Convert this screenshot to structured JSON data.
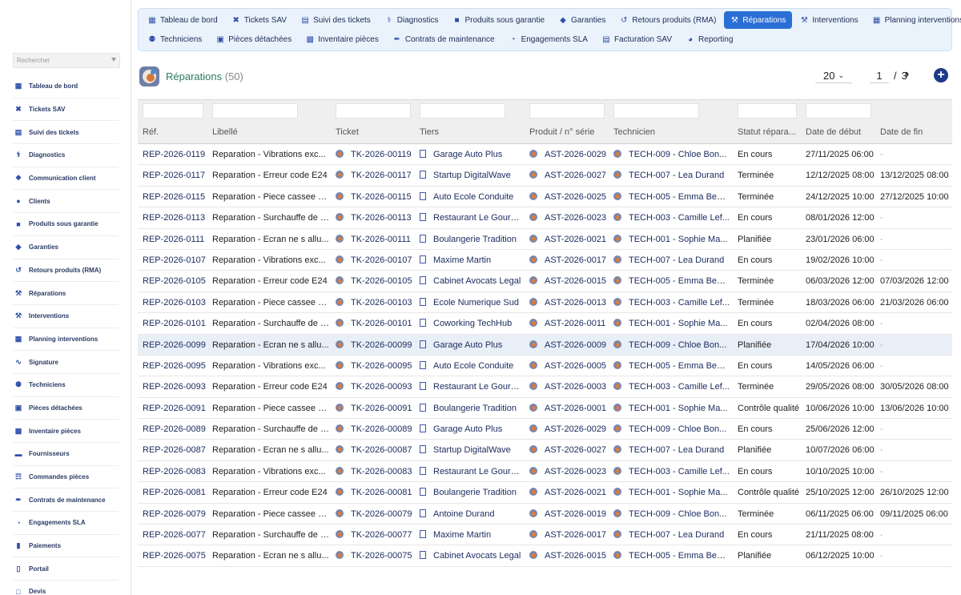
{
  "sidebar": {
    "search_placeholder": "Rechercher",
    "items": [
      {
        "label": "Tableau de bord",
        "icon": "dashboard-icon"
      },
      {
        "label": "Tickets SAV",
        "icon": "ticket-icon"
      },
      {
        "label": "Suivi des tickets",
        "icon": "table-icon"
      },
      {
        "label": "Diagnostics",
        "icon": "stethoscope-icon"
      },
      {
        "label": "Communication client",
        "icon": "chat-icon"
      },
      {
        "label": "Clients",
        "icon": "user-icon"
      },
      {
        "label": "Produits sous garantie",
        "icon": "briefcase-icon"
      },
      {
        "label": "Garanties",
        "icon": "shield-icon"
      },
      {
        "label": "Retours produits (RMA)",
        "icon": "undo-icon"
      },
      {
        "label": "Réparations",
        "icon": "tools-icon"
      },
      {
        "label": "Interventions",
        "icon": "wrench-icon"
      },
      {
        "label": "Planning interventions",
        "icon": "calendar-icon"
      },
      {
        "label": "Signature",
        "icon": "signature-icon"
      },
      {
        "label": "Techniciens",
        "icon": "users-icon"
      },
      {
        "label": "Pièces détachées",
        "icon": "cube-icon"
      },
      {
        "label": "Inventaire pièces",
        "icon": "boxes-icon"
      },
      {
        "label": "Fournisseurs",
        "icon": "truck-icon"
      },
      {
        "label": "Commandes pièces",
        "icon": "cart-icon"
      },
      {
        "label": "Contrats de maintenance",
        "icon": "contract-icon"
      },
      {
        "label": "Engagements SLA",
        "icon": "clock-icon"
      },
      {
        "label": "Paiements",
        "icon": "money-icon"
      },
      {
        "label": "Portail",
        "icon": "tablet-icon"
      },
      {
        "label": "Devis",
        "icon": "file-icon"
      }
    ]
  },
  "topmenu": {
    "row1": [
      {
        "label": "Tableau de bord",
        "icon": "dashboard-icon"
      },
      {
        "label": "Tickets SAV",
        "icon": "ticket-icon"
      },
      {
        "label": "Suivi des tickets",
        "icon": "table-icon"
      },
      {
        "label": "Diagnostics",
        "icon": "stethoscope-icon"
      },
      {
        "label": "Produits sous garantie",
        "icon": "briefcase-icon"
      },
      {
        "label": "Garanties",
        "icon": "shield-icon"
      },
      {
        "label": "Retours produits (RMA)",
        "icon": "undo-icon"
      },
      {
        "label": "Réparations",
        "icon": "tools-icon",
        "active": true
      },
      {
        "label": "Interventions",
        "icon": "wrench-icon"
      },
      {
        "label": "Planning interventions",
        "icon": "calendar-icon"
      }
    ],
    "row2": [
      {
        "label": "Techniciens",
        "icon": "users-icon"
      },
      {
        "label": "Pièces détachées",
        "icon": "cube-icon"
      },
      {
        "label": "Inventaire pièces",
        "icon": "boxes-icon"
      },
      {
        "label": "Contrats de maintenance",
        "icon": "contract-icon"
      },
      {
        "label": "Engagements SLA",
        "icon": "clock-icon"
      },
      {
        "label": "Facturation SAV",
        "icon": "invoice-icon"
      },
      {
        "label": "Reporting",
        "icon": "chart-pie-icon"
      }
    ]
  },
  "list": {
    "title": "Réparations",
    "count": "(50)",
    "page_size": "20",
    "page": "1",
    "page_sep": "/",
    "total_pages": "3",
    "add_label": "+"
  },
  "colors": {
    "accent": "#2a6fd6",
    "title": "#2d7a5e",
    "link": "#1a2a5e"
  },
  "table": {
    "columns": [
      "Réf.",
      "Libellé",
      "Ticket",
      "Tiers",
      "Produit / n° série",
      "Technicien",
      "Statut répara...",
      "Date de début",
      "Date de fin"
    ],
    "rows": [
      [
        "REP-2026-0119",
        "Reparation - Vibrations exc...",
        "TK-2026-00119",
        "Garage Auto Plus",
        "AST-2026-0029",
        "TECH-009 - Chloe Bon...",
        "En cours",
        "27/11/2025 06:00",
        "-"
      ],
      [
        "REP-2026-0117",
        "Reparation - Erreur code E24",
        "TK-2026-00117",
        "Startup DigitalWave",
        "AST-2026-0027",
        "TECH-007 - Lea Durand",
        "Terminée",
        "12/12/2025 08:00",
        "13/12/2025 08:00"
      ],
      [
        "REP-2026-0115",
        "Reparation - Piece cassee a...",
        "TK-2026-00115",
        "Auto Ecole Conduite",
        "AST-2026-0025",
        "TECH-005 - Emma Benali",
        "Terminée",
        "24/12/2025 10:00",
        "27/12/2025 10:00"
      ],
      [
        "REP-2026-0113",
        "Reparation - Surchauffe de l...",
        "TK-2026-00113",
        "Restaurant Le Gourmet",
        "AST-2026-0023",
        "TECH-003 - Camille Lef...",
        "En cours",
        "08/01/2026 12:00",
        "-"
      ],
      [
        "REP-2026-0111",
        "Reparation - Ecran ne s allu...",
        "TK-2026-00111",
        "Boulangerie Tradition",
        "AST-2026-0021",
        "TECH-001 - Sophie Ma...",
        "Planifiée",
        "23/01/2026 06:00",
        "-"
      ],
      [
        "REP-2026-0107",
        "Reparation - Vibrations exc...",
        "TK-2026-00107",
        "Maxime Martin",
        "AST-2026-0017",
        "TECH-007 - Lea Durand",
        "En cours",
        "19/02/2026 10:00",
        "-"
      ],
      [
        "REP-2026-0105",
        "Reparation - Erreur code E24",
        "TK-2026-00105",
        "Cabinet Avocats Legal",
        "AST-2026-0015",
        "TECH-005 - Emma Benali",
        "Terminée",
        "06/03/2026 12:00",
        "07/03/2026 12:00"
      ],
      [
        "REP-2026-0103",
        "Reparation - Piece cassee a...",
        "TK-2026-00103",
        "Ecole Numerique Sud",
        "AST-2026-0013",
        "TECH-003 - Camille Lef...",
        "Terminée",
        "18/03/2026 06:00",
        "21/03/2026 06:00"
      ],
      [
        "REP-2026-0101",
        "Reparation - Surchauffe de l...",
        "TK-2026-00101",
        "Coworking TechHub",
        "AST-2026-0011",
        "TECH-001 - Sophie Ma...",
        "En cours",
        "02/04/2026 08:00",
        "-"
      ],
      [
        "REP-2026-0099",
        "Reparation - Ecran ne s allu...",
        "TK-2026-00099",
        "Garage Auto Plus",
        "AST-2026-0009",
        "TECH-009 - Chloe Bon...",
        "Planifiée",
        "17/04/2026 10:00",
        "-"
      ],
      [
        "REP-2026-0095",
        "Reparation - Vibrations exc...",
        "TK-2026-00095",
        "Auto Ecole Conduite",
        "AST-2026-0005",
        "TECH-005 - Emma Benali",
        "En cours",
        "14/05/2026 06:00",
        "-"
      ],
      [
        "REP-2026-0093",
        "Reparation - Erreur code E24",
        "TK-2026-00093",
        "Restaurant Le Gourmet",
        "AST-2026-0003",
        "TECH-003 - Camille Lef...",
        "Terminée",
        "29/05/2026 08:00",
        "30/05/2026 08:00"
      ],
      [
        "REP-2026-0091",
        "Reparation - Piece cassee a...",
        "TK-2026-00091",
        "Boulangerie Tradition",
        "AST-2026-0001",
        "TECH-001 - Sophie Ma...",
        "Contrôle qualité",
        "10/06/2026 10:00",
        "13/06/2026 10:00"
      ],
      [
        "REP-2026-0089",
        "Reparation - Surchauffe de l...",
        "TK-2026-00089",
        "Garage Auto Plus",
        "AST-2026-0029",
        "TECH-009 - Chloe Bon...",
        "En cours",
        "25/06/2026 12:00",
        "-"
      ],
      [
        "REP-2026-0087",
        "Reparation - Ecran ne s allu...",
        "TK-2026-00087",
        "Startup DigitalWave",
        "AST-2026-0027",
        "TECH-007 - Lea Durand",
        "Planifiée",
        "10/07/2026 06:00",
        "-"
      ],
      [
        "REP-2026-0083",
        "Reparation - Vibrations exc...",
        "TK-2026-00083",
        "Restaurant Le Gourmet",
        "AST-2026-0023",
        "TECH-003 - Camille Lef...",
        "En cours",
        "10/10/2025 10:00",
        "-"
      ],
      [
        "REP-2026-0081",
        "Reparation - Erreur code E24",
        "TK-2026-00081",
        "Boulangerie Tradition",
        "AST-2026-0021",
        "TECH-001 - Sophie Ma...",
        "Contrôle qualité",
        "25/10/2025 12:00",
        "26/10/2025 12:00"
      ],
      [
        "REP-2026-0079",
        "Reparation - Piece cassee a...",
        "TK-2026-00079",
        "Antoine Durand",
        "AST-2026-0019",
        "TECH-009 - Chloe Bon...",
        "Terminée",
        "06/11/2025 06:00",
        "09/11/2025 06:00"
      ],
      [
        "REP-2026-0077",
        "Reparation - Surchauffe de l...",
        "TK-2026-00077",
        "Maxime Martin",
        "AST-2026-0017",
        "TECH-007 - Lea Durand",
        "En cours",
        "21/11/2025 08:00",
        "-"
      ],
      [
        "REP-2026-0075",
        "Reparation - Ecran ne s allu...",
        "TK-2026-00075",
        "Cabinet Avocats Legal",
        "AST-2026-0015",
        "TECH-005 - Emma Benali",
        "Planifiée",
        "06/12/2025 10:00",
        "-"
      ]
    ],
    "highlighted_row": 9
  }
}
